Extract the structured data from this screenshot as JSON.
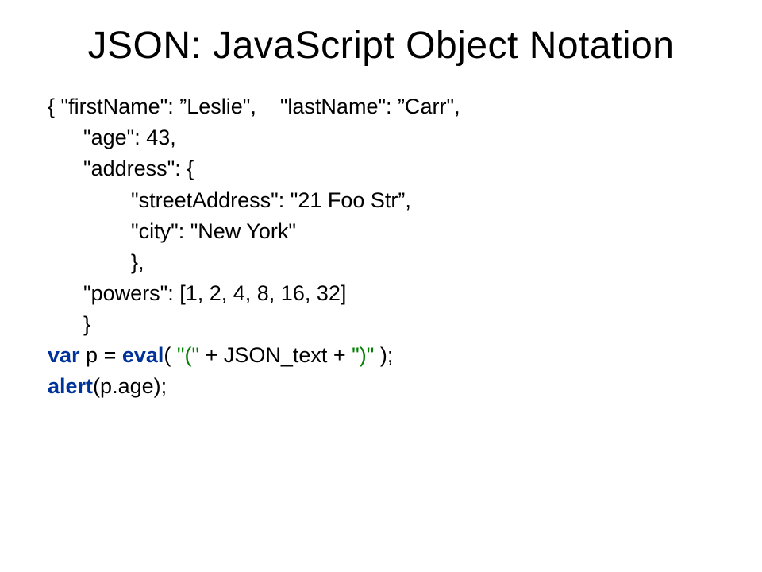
{
  "title": "JSON: JavaScript Object Notation",
  "json_lines": [
    "{ \"firstName\": ”Leslie\",    \"lastName\": ”Carr\",",
    "      \"age\": 43,",
    "      \"address\": {",
    "              \"streetAddress\": \"21 Foo Str”,",
    "              \"city\": \"New York\"",
    "              },",
    "      \"powers\": [1, 2, 4, 8, 16, 32]",
    "      }"
  ],
  "code": {
    "kw_var": "var",
    "var_p_eq": " p = ",
    "kw_eval": "eval",
    "eval_paren_open": "(",
    "eval_str1": " \"(\" ",
    "eval_plus1": "+ JSON_text + ",
    "eval_str2": "\")\" ",
    "eval_paren_close": ");",
    "kw_alert": "alert",
    "alert_open": "(",
    "alert_arg": "p.age",
    "alert_close": ");"
  }
}
